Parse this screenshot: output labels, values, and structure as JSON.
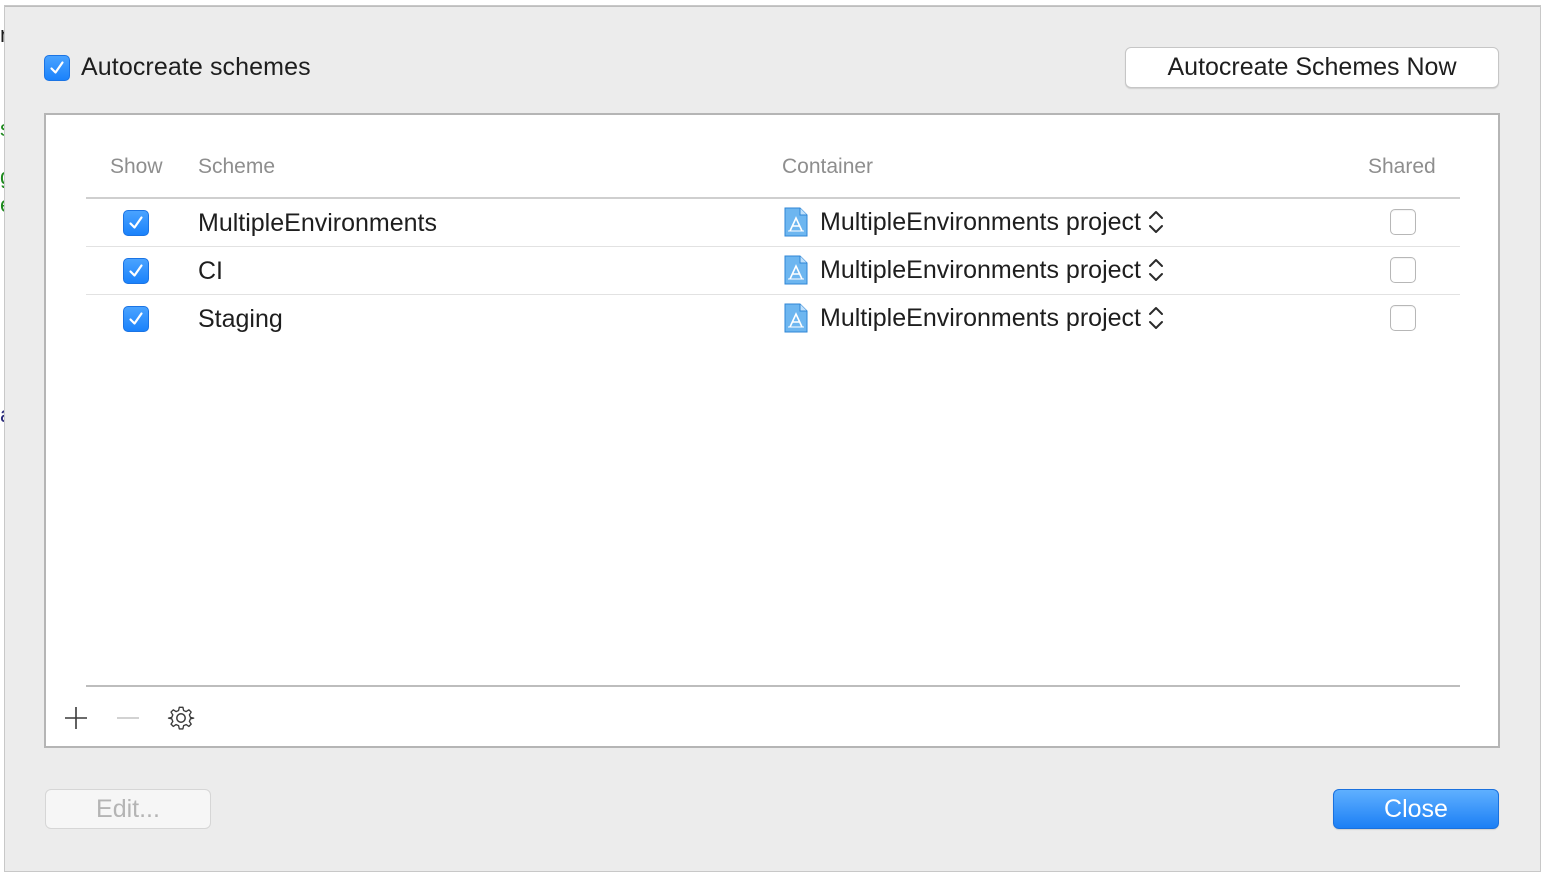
{
  "background_edge_chars": [
    {
      "char": "n",
      "color": "#1e1e1e"
    },
    {
      "char": "s",
      "color": "#1f8a1f"
    },
    {
      "char": "g",
      "color": "#1f8a1f"
    },
    {
      "char": "e",
      "color": "#1f8a1f"
    },
    {
      "char": "a",
      "color": "#2b2b7a"
    }
  ],
  "top": {
    "autocreate_checkbox": {
      "label": "Autocreate schemes",
      "checked": true
    },
    "autocreate_now_button": "Autocreate Schemes Now"
  },
  "table": {
    "columns": {
      "show": "Show",
      "scheme": "Scheme",
      "container": "Container",
      "shared": "Shared"
    },
    "rows": [
      {
        "show": true,
        "scheme": "MultipleEnvironments",
        "container": "MultipleEnvironments project",
        "container_icon": "xcode-project-icon",
        "shared": false
      },
      {
        "show": true,
        "scheme": "CI",
        "container": "MultipleEnvironments project",
        "container_icon": "xcode-project-icon",
        "shared": false
      },
      {
        "show": true,
        "scheme": "Staging",
        "container": "MultipleEnvironments project",
        "container_icon": "xcode-project-icon",
        "shared": false
      }
    ]
  },
  "footer_tools": [
    {
      "name": "add-icon",
      "enabled": true
    },
    {
      "name": "remove-icon",
      "enabled": false
    },
    {
      "name": "gear-icon",
      "enabled": true
    }
  ],
  "buttons": {
    "edit": "Edit...",
    "close": "Close"
  },
  "colors": {
    "accent": "#1c7ff5",
    "sheet_background": "#ececec",
    "header_text": "#8e8e8e"
  }
}
